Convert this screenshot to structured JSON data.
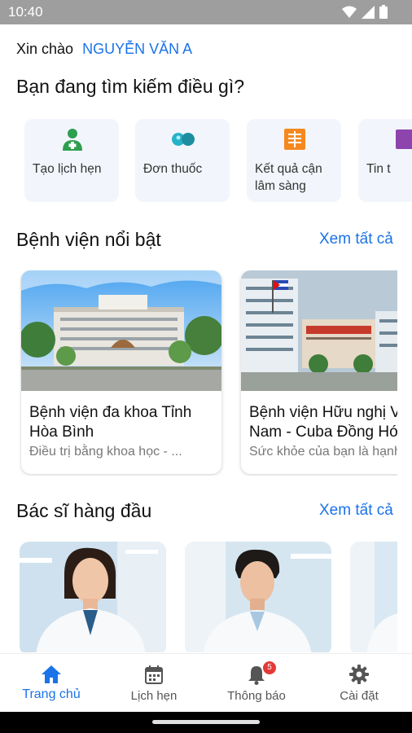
{
  "status_bar": {
    "time": "10:40"
  },
  "greeting": {
    "prefix": "Xin chào",
    "name": "NGUYỄN VĂN A"
  },
  "question": "Bạn đang tìm kiếm điều gì?",
  "quick_actions": [
    {
      "label": "Tạo lịch hẹn",
      "icon": "doctor-icon"
    },
    {
      "label": "Đơn thuốc",
      "icon": "pill-icon"
    },
    {
      "label": "Kết quả cận\nlâm sàng",
      "icon": "xray-icon"
    },
    {
      "label": "Tin t",
      "icon": "news-icon"
    }
  ],
  "featured_hospitals": {
    "title": "Bệnh viện nổi bật",
    "see_all": "Xem tất cả",
    "items": [
      {
        "name": "Bệnh viện đa khoa Tỉnh Hòa Bình",
        "tagline": "Điều trị bằng khoa học - ..."
      },
      {
        "name": "Bệnh viện Hữu nghị Việt Nam - Cuba Đồng Hới",
        "tagline": "Sức khỏe của bạn là hạnh phúc"
      }
    ]
  },
  "top_doctors": {
    "title": "Bác sĩ hàng đầu",
    "see_all": "Xem tất cả"
  },
  "bottom_nav": [
    {
      "label": "Trang chủ",
      "icon": "home-icon",
      "active": true
    },
    {
      "label": "Lịch hẹn",
      "icon": "calendar-icon",
      "active": false
    },
    {
      "label": "Thông báo",
      "icon": "bell-icon",
      "active": false,
      "badge": "5"
    },
    {
      "label": "Cài đặt",
      "icon": "gear-icon",
      "active": false
    }
  ],
  "colors": {
    "accent": "#1a73e8",
    "card_bg": "#f2f6fc",
    "badge": "#e53935"
  }
}
